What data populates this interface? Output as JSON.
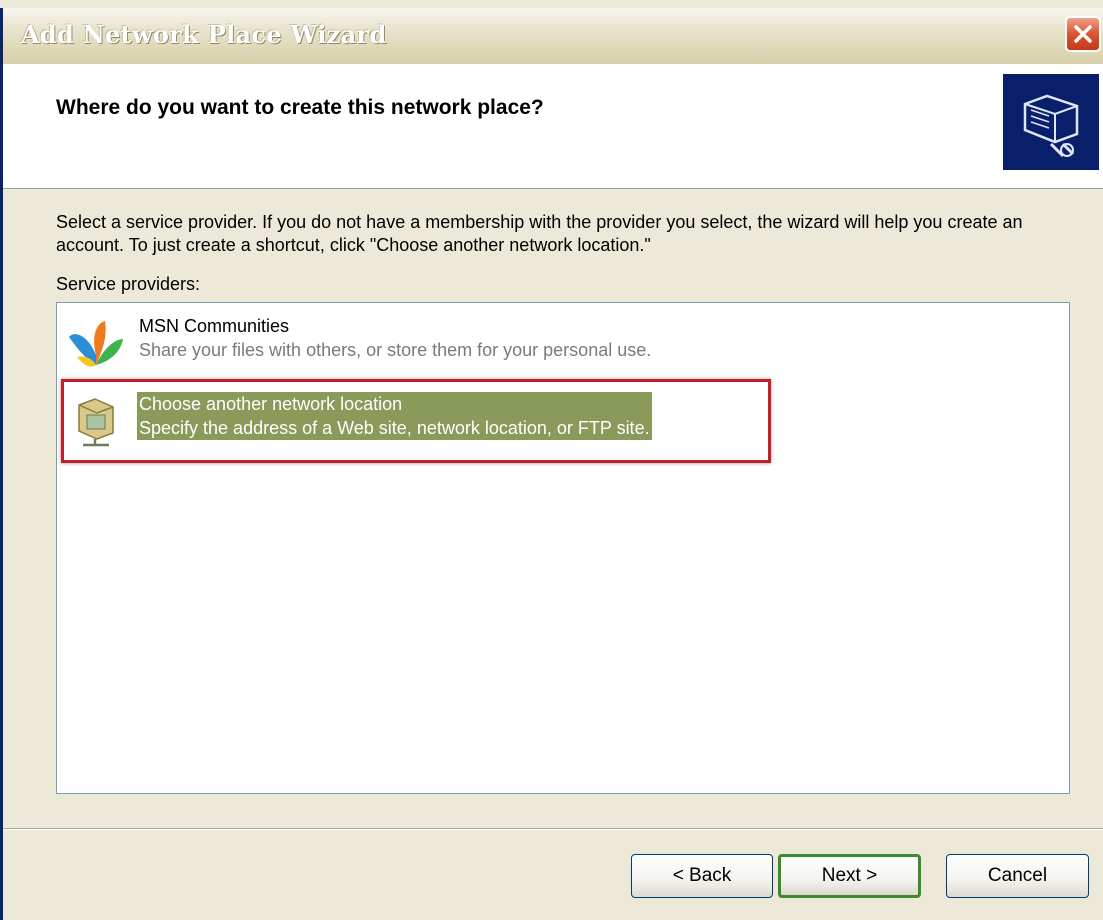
{
  "window": {
    "title": "Add Network Place Wizard",
    "close_glyph": "✕"
  },
  "header": {
    "title": "Where do you want to create this network place?",
    "icon": "network-folder-icon"
  },
  "body": {
    "instruction": "Select a service provider.  If you do not have a membership with the provider you select, the wizard will help you create an account.  To just create a shortcut, click \"Choose another network location.\"",
    "providers_label": "Service providers:",
    "providers": [
      {
        "name": "MSN Communities",
        "description": "Share your files with others, or store them for your personal use.",
        "icon": "msn-butterfly-icon",
        "selected": false
      },
      {
        "name": "Choose another network location",
        "description": "Specify the address of a Web site, network location, or FTP site.",
        "icon": "network-location-icon",
        "selected": true
      }
    ]
  },
  "buttons": {
    "back": "< Back",
    "next": "Next >",
    "cancel": "Cancel"
  },
  "colors": {
    "selection": "#8a9a5b",
    "highlight_border": "#c0202a",
    "dialog_background": "#ece9d8",
    "close_button": "#d9542f"
  }
}
